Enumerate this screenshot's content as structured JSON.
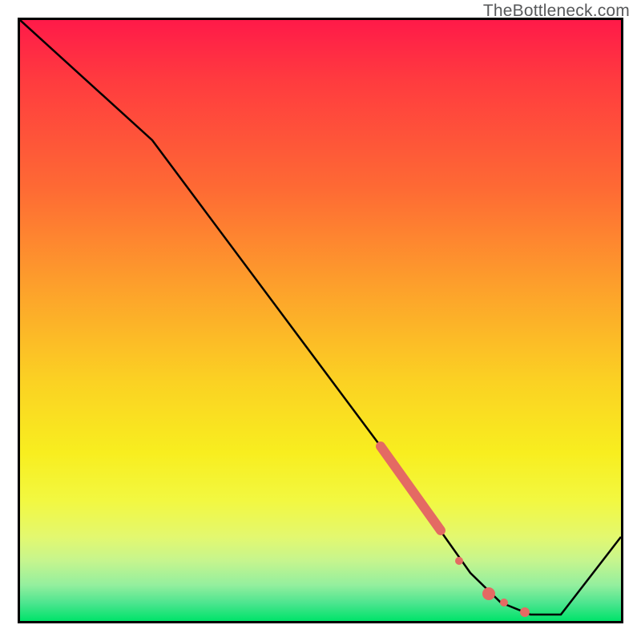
{
  "watermark": "TheBottleneck.com",
  "chart_data": {
    "type": "line",
    "title": "",
    "xlabel": "",
    "ylabel": "",
    "xlim": [
      0,
      100
    ],
    "ylim": [
      0,
      100
    ],
    "grid": false,
    "legend": false,
    "note": "Axes are unlabeled in the source image; values are normalized 0–100. y=100 is top (red/bottleneck), y=0 is bottom (green/optimal).",
    "series": [
      {
        "name": "bottleneck-curve",
        "color": "#000000",
        "stroke_width": 2,
        "points": [
          {
            "x": 0,
            "y": 100
          },
          {
            "x": 22,
            "y": 80
          },
          {
            "x": 60,
            "y": 29
          },
          {
            "x": 75,
            "y": 8
          },
          {
            "x": 80,
            "y": 3
          },
          {
            "x": 85,
            "y": 1
          },
          {
            "x": 90,
            "y": 1
          },
          {
            "x": 100,
            "y": 14
          }
        ]
      },
      {
        "name": "highlight-segment",
        "color": "#e46a63",
        "stroke_width": 9,
        "linecap": "round",
        "points": [
          {
            "x": 60,
            "y": 29
          },
          {
            "x": 70,
            "y": 15
          }
        ]
      }
    ],
    "markers": [
      {
        "name": "dot-1",
        "x": 73,
        "y": 10,
        "r": 5,
        "color": "#e46a63"
      },
      {
        "name": "dot-2",
        "x": 78,
        "y": 4.5,
        "r": 7,
        "color": "#e46a63"
      },
      {
        "name": "dot-3",
        "x": 80.5,
        "y": 3,
        "r": 4,
        "color": "#e46a63"
      },
      {
        "name": "dot-4",
        "x": 84,
        "y": 1.5,
        "r": 5,
        "color": "#e46a63"
      }
    ]
  }
}
